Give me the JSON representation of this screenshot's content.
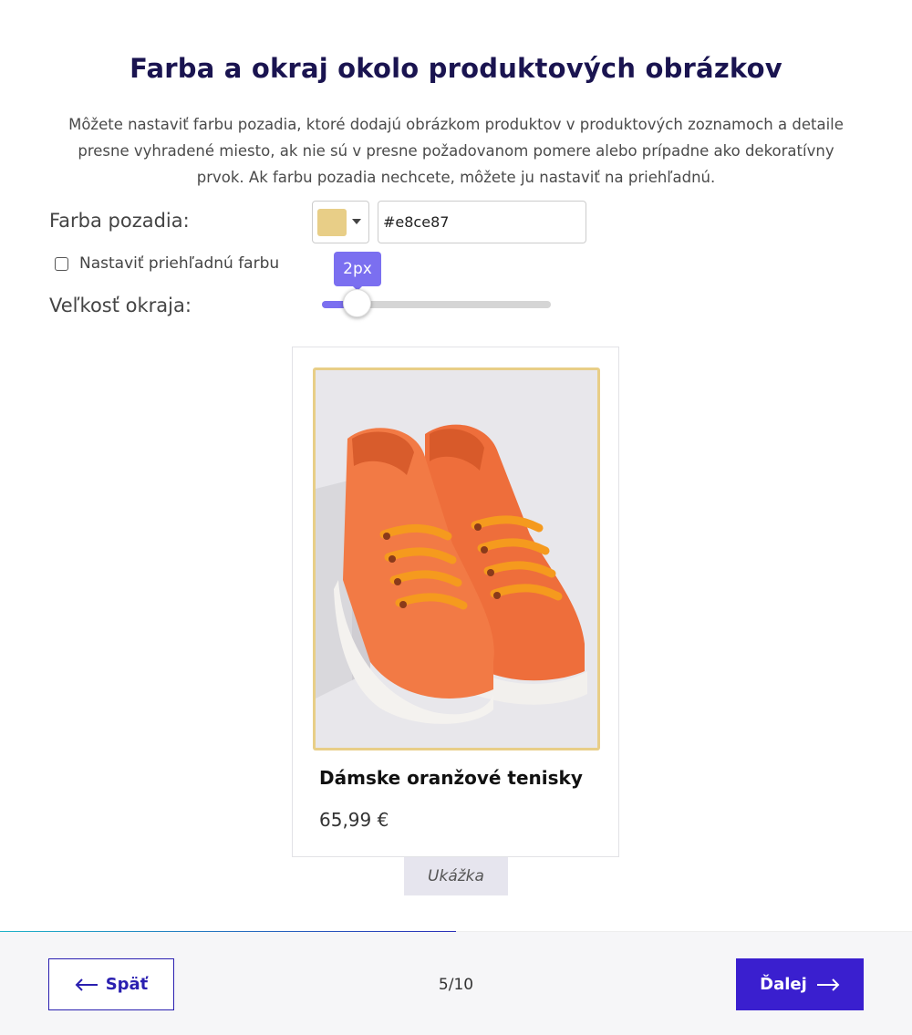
{
  "header": {
    "title": "Farba a okraj okolo produktových obrázkov",
    "description": "Môžete nastaviť farbu pozadia, ktoré dodajú obrázkom produktov v produktových zoznamoch a detaile presne vyhradené miesto, ak nie sú v presne požadovanom pomere alebo prípadne ako dekoratívny prvok. Ak farbu pozadia nechcete, môžete ju nastaviť na priehľadnú."
  },
  "settings": {
    "background_label": "Farba pozadia:",
    "background_color": "#e8ce87",
    "transparent_label": "Nastaviť priehľadnú farbu",
    "transparent_checked": false,
    "border_label": "Veľkosť okraja:",
    "border_value": "2px",
    "border_slider_fraction": 0.15
  },
  "preview": {
    "product_name": "Dámske oranžové tenisky",
    "price": "65,99 €",
    "tag": "Ukážka"
  },
  "footer": {
    "back_label": "Späť",
    "next_label": "Ďalej",
    "page_indicator": "5/10",
    "progress_fraction": 0.5
  },
  "colors": {
    "accent": "#3a1fcf",
    "slider": "#7b6ff0",
    "title": "#1a1450",
    "product": "#f0743e"
  }
}
